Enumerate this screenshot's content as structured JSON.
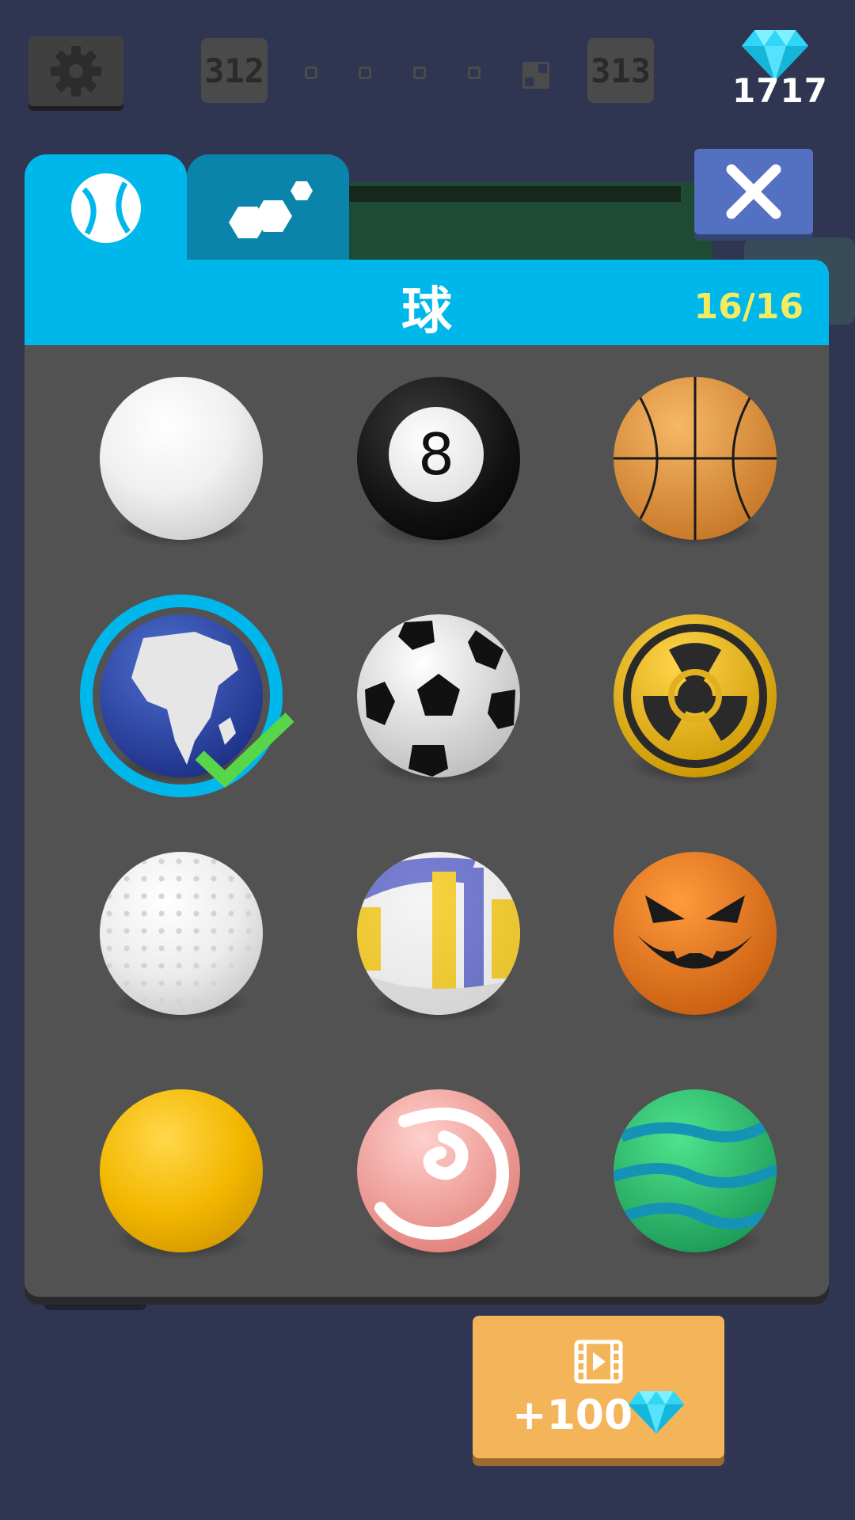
{
  "top_bar": {
    "current_level": "312",
    "next_level": "313",
    "gem_count": "1717"
  },
  "tabs": [
    {
      "name": "balls",
      "active": true
    },
    {
      "name": "trails",
      "active": false
    }
  ],
  "panel": {
    "title": "球",
    "count": "16/16"
  },
  "balls": [
    {
      "name": "white-ball",
      "selected": false
    },
    {
      "name": "eight-ball",
      "label": "8",
      "selected": false
    },
    {
      "name": "basketball",
      "selected": false
    },
    {
      "name": "earth-ball",
      "selected": true
    },
    {
      "name": "soccer-ball",
      "selected": false
    },
    {
      "name": "radiation-ball",
      "selected": false
    },
    {
      "name": "golf-ball",
      "selected": false
    },
    {
      "name": "volleyball",
      "selected": false
    },
    {
      "name": "pumpkin-ball",
      "selected": false
    },
    {
      "name": "yellow-lowpoly-ball",
      "selected": false
    },
    {
      "name": "candy-swirl-ball",
      "selected": false
    },
    {
      "name": "green-stripe-ball",
      "selected": false
    }
  ],
  "reward_button": {
    "label": "+100",
    "icon": "video-icon"
  },
  "colors": {
    "accent": "#00b7ec",
    "gem": "#2fd6f5",
    "reward": "#f4b459",
    "count_text": "#f3eb62"
  }
}
